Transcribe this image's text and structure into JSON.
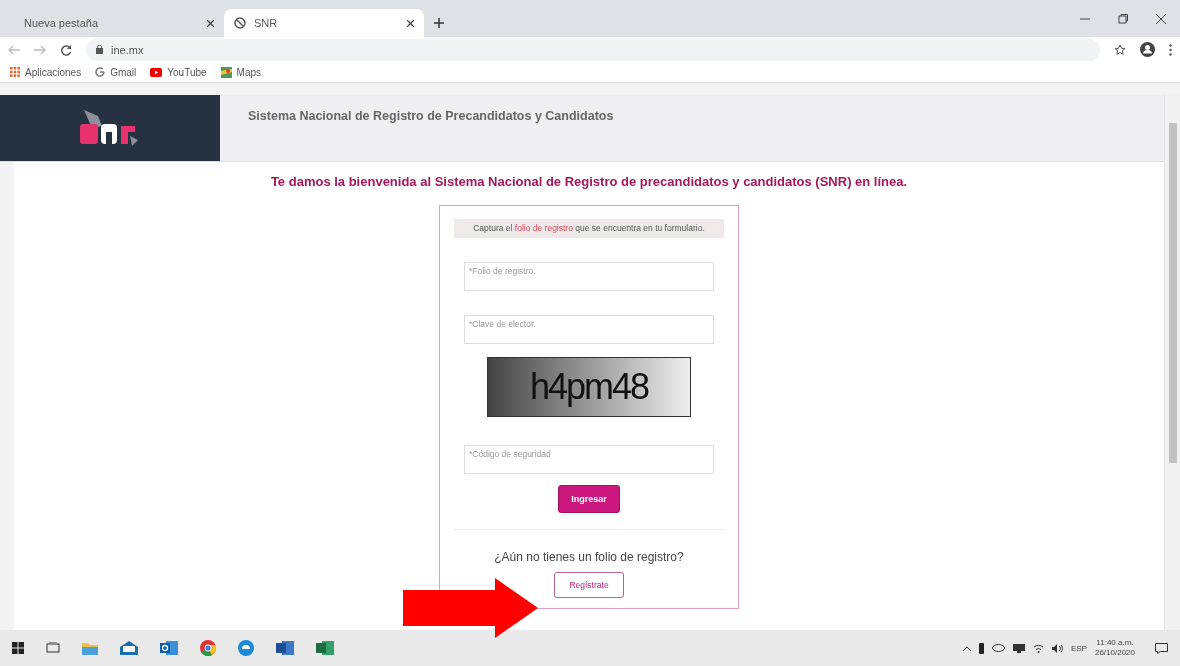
{
  "tabs": [
    {
      "label": "Nueva pestaña",
      "selected": false
    },
    {
      "label": "SNR",
      "selected": true
    }
  ],
  "address": "ine.mx",
  "bookmarks": [
    {
      "label": "Aplicaciones",
      "kind": "apps"
    },
    {
      "label": "Gmail",
      "kind": "gmail"
    },
    {
      "label": "YouTube",
      "kind": "youtube"
    },
    {
      "label": "Maps",
      "kind": "maps"
    }
  ],
  "header": {
    "title": "Sistema Nacional de Registro de Precandidatos y Candidatos"
  },
  "welcome": "Te damos la bienvenida al Sistema Nacional de Registro de precandidatos y candidatos (SNR) en línea.",
  "form": {
    "instruction_before": "Captura el ",
    "instruction_link": "folio de registro",
    "instruction_after": " que se encuentra en tu formulario.",
    "fields": [
      {
        "placeholder": "*Folio de registro."
      },
      {
        "placeholder": "*Clave de elector."
      }
    ],
    "captcha": "h4pm48",
    "security_field": {
      "placeholder": "*Código de seguridad"
    },
    "submit": "Ingresar",
    "question": "¿Aún no tienes un folio de registro?",
    "register": "Regístrate"
  },
  "taskbar": {
    "language": "ESP",
    "time": "11:40 a.m.",
    "date": "26/10/2020"
  }
}
